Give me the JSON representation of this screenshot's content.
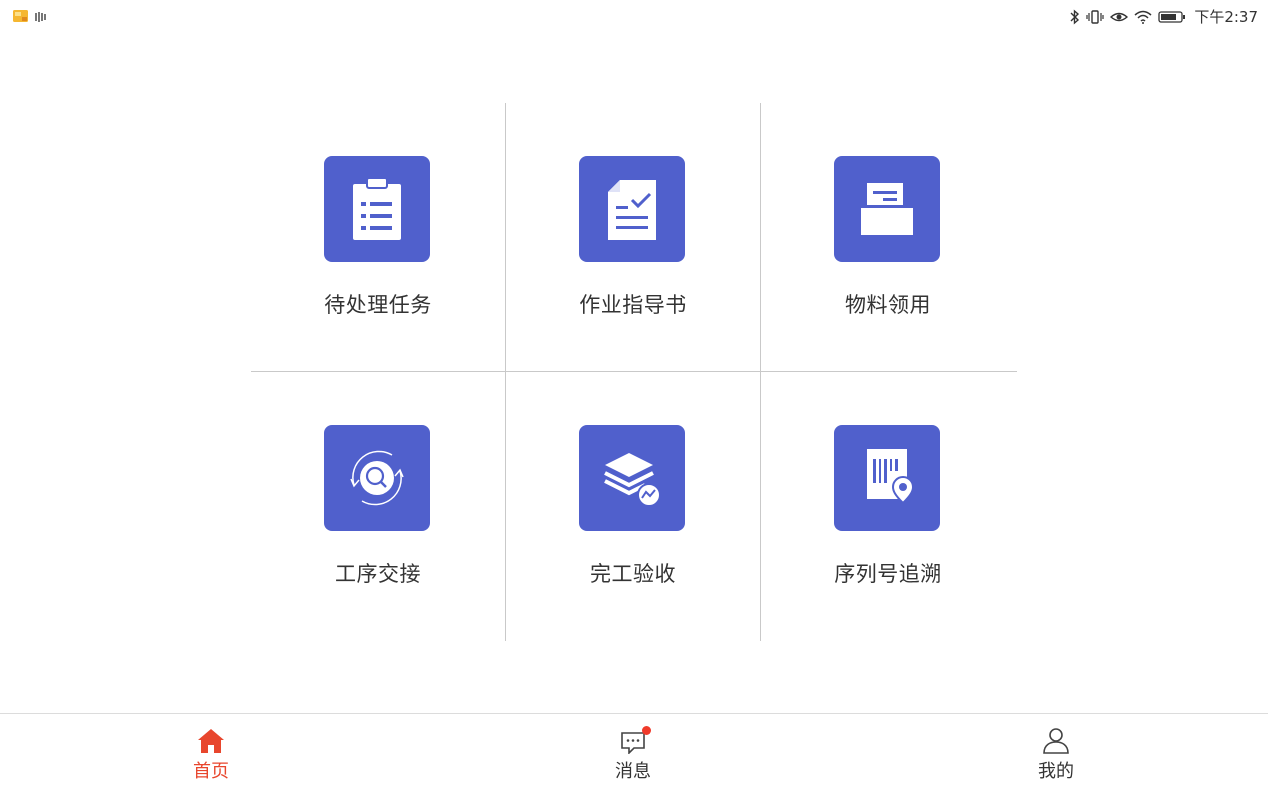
{
  "status_bar": {
    "time": "下午2:37",
    "left_icons": [
      "gallery-notification-icon",
      "sound-wave-icon"
    ],
    "right_icons": [
      "bluetooth-icon",
      "vibrate-icon",
      "eye-comfort-icon",
      "wifi-icon",
      "battery-icon"
    ]
  },
  "grid": {
    "items": [
      {
        "label": "待处理任务",
        "icon": "clipboard-list-icon"
      },
      {
        "label": "作业指导书",
        "icon": "document-check-icon"
      },
      {
        "label": "物料领用",
        "icon": "printer-tray-icon"
      },
      {
        "label": "工序交接",
        "icon": "rotate-search-icon"
      },
      {
        "label": "完工验收",
        "icon": "layers-chart-icon"
      },
      {
        "label": "序列号追溯",
        "icon": "barcode-location-icon"
      }
    ]
  },
  "bottom_nav": {
    "items": [
      {
        "label": "首页",
        "icon": "home-icon",
        "active": true
      },
      {
        "label": "消息",
        "icon": "message-icon",
        "badge": true
      },
      {
        "label": "我的",
        "icon": "user-icon"
      }
    ]
  },
  "colors": {
    "accent": "#e8462d",
    "tile": "#5060cc",
    "divider": "#c9c9c9"
  }
}
